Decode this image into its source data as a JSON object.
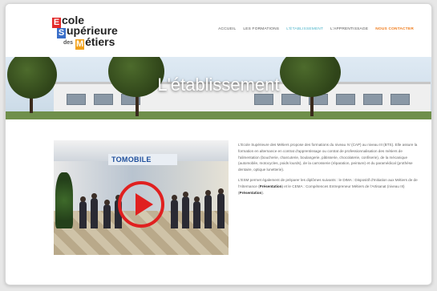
{
  "logo": {
    "line1_cap": "E",
    "line1_rest": "cole",
    "line2_cap": "S",
    "line2_rest": "upérieure",
    "line3_small": "des",
    "line3_cap": "M",
    "line3_rest": "étiers"
  },
  "nav": {
    "items": [
      {
        "label": "ACCUEIL"
      },
      {
        "label": "LES FORMATIONS"
      },
      {
        "label": "L'ÉTABLISSEMENT"
      },
      {
        "label": "L'APPRENTISSAGE"
      },
      {
        "label": "NOUS CONTACTER"
      }
    ]
  },
  "banner": {
    "title": "L'établissement"
  },
  "video": {
    "sign_text": "TOMOBILE"
  },
  "content": {
    "p1": "L'Ecole Supérieure des Métiers propose des formations du niveau IV (CAP) au niveau III (BTS). Elle assure la formation en alternance en contrat d'apprentissage ou contrat de professionnalisation des métiers de l'alimentation (boucherie, charcuterie, boulangerie, pâtisserie, chocolaterie, confiserie), de la mécanique (automobile, motocycles, poids lourds), de la carrosserie (réparation, peinture) et du paramédical (prothèse dentaire, optique lunetterie).",
    "p2_text": "L'ESM permet également de préparer les diplômes suivants : le DIMA : Dispositif d'Initiation aux Métiers de de l'Alternance (",
    "p2_link1": "Présentation",
    "p2_mid": ") et le CEMA : Compétences Entrepreneur Métiers de l'Artisanat (niveau III) (",
    "p2_link2": "Présentation",
    "p2_end": ")."
  }
}
